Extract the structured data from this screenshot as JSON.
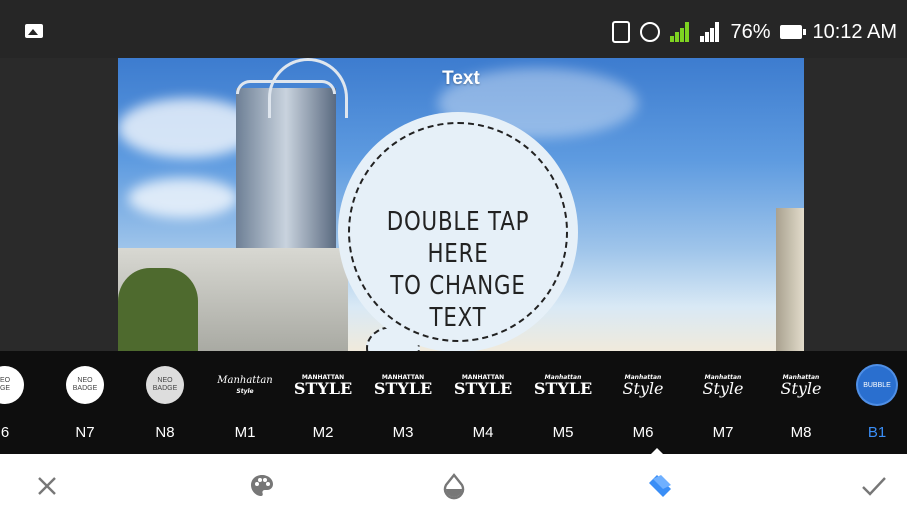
{
  "status_bar": {
    "battery": "76%",
    "time": "10:12 AM",
    "icons": [
      "gallery-icon",
      "vibrate-icon",
      "alarm-icon",
      "signal-icon",
      "signal-icon",
      "battery-icon"
    ]
  },
  "canvas": {
    "title": "Text",
    "bubble_text_line1": "DOUBLE TAP HERE",
    "bubble_text_line2": "TO CHANGE TEXT"
  },
  "styles": {
    "selected": "B1",
    "items": [
      {
        "label": "6",
        "thumb_line1": "EO",
        "thumb_line2": "GE"
      },
      {
        "label": "N7",
        "thumb_line1": "NEO",
        "thumb_line2": "BADGE"
      },
      {
        "label": "N8",
        "thumb_line1": "NEO",
        "thumb_line2": "BADGE"
      },
      {
        "label": "M1",
        "thumb_line1": "Manhattan",
        "thumb_line2": "Style"
      },
      {
        "label": "M2",
        "thumb_line1": "MANHATTAN",
        "thumb_line2": "STYLE"
      },
      {
        "label": "M3",
        "thumb_line1": "MANHATTAN",
        "thumb_line2": "STYLE"
      },
      {
        "label": "M4",
        "thumb_line1": "MANHATTAN",
        "thumb_line2": "STYLE"
      },
      {
        "label": "M5",
        "thumb_line1": "Manhattan",
        "thumb_line2": "STYLE"
      },
      {
        "label": "M6",
        "thumb_line1": "Manhattan",
        "thumb_line2": "Style"
      },
      {
        "label": "M7",
        "thumb_line1": "Manhattan",
        "thumb_line2": "Style"
      },
      {
        "label": "M8",
        "thumb_line1": "Manhattan",
        "thumb_line2": "Style"
      },
      {
        "label": "B1",
        "thumb_line1": "BUBBLE",
        "thumb_line2": ""
      }
    ]
  },
  "toolbar": {
    "icons": [
      "close-icon",
      "palette-icon",
      "opacity-icon",
      "style-icon",
      "check-icon"
    ],
    "active_color": "#3a8ef6"
  }
}
